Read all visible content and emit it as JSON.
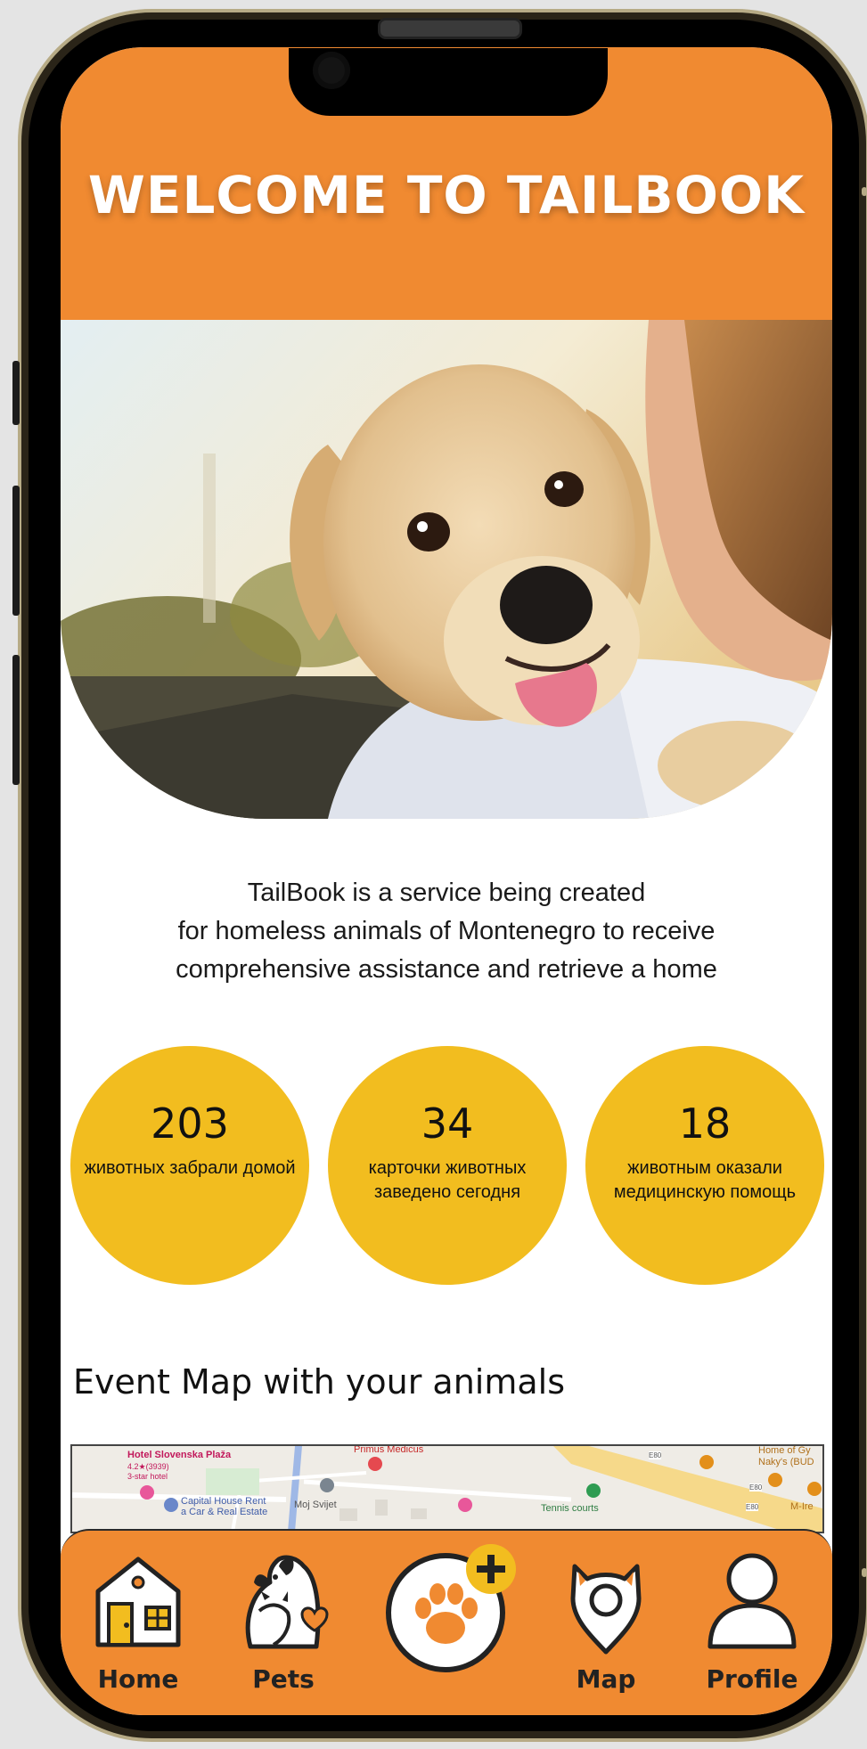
{
  "header": {
    "title": "WELCOME TO TAILBOOK"
  },
  "hero": {
    "image": "puppy-on-shoulder-photo"
  },
  "intro": {
    "lines": [
      "TailBook is a service being created",
      "for homeless animals of Montenegro to receive",
      "comprehensive assistance and retrieve a home"
    ]
  },
  "stats": [
    {
      "value": "203",
      "label": "животных забрали домой"
    },
    {
      "value": "34",
      "label": "карточки животных заведено сегодня"
    },
    {
      "value": "18",
      "label": "животным оказали медицинскую помощь"
    }
  ],
  "events": {
    "title": "Event Map with your animals"
  },
  "map": {
    "labels": {
      "hotel": "Hotel Slovenska Plaža",
      "rating": "4.2★(3939)",
      "hotel_type": "3-star hotel",
      "primus": "Primus Medicus",
      "capital": "Capital House Rent",
      "capital2": "a Car & Real Estate",
      "moj": "Moj Svijet",
      "tennis": "Tennis courts",
      "home": "Home of Gy",
      "naky": "Naky's (BUD",
      "mler": "M-Ire",
      "e80a": "E80",
      "e80b": "E80",
      "e80c": "E80"
    }
  },
  "nav": {
    "home": "Home",
    "pets": "Pets",
    "map": "Map",
    "profile": "Profile"
  },
  "colors": {
    "primary_orange": "#f08a31",
    "stat_yellow": "#f2bd1f"
  },
  "icons": {
    "home": "house-icon",
    "pets": "cat-dog-heart-icon",
    "add": "paw-plus-icon",
    "map": "map-pin-cat-icon",
    "profile": "person-icon"
  }
}
